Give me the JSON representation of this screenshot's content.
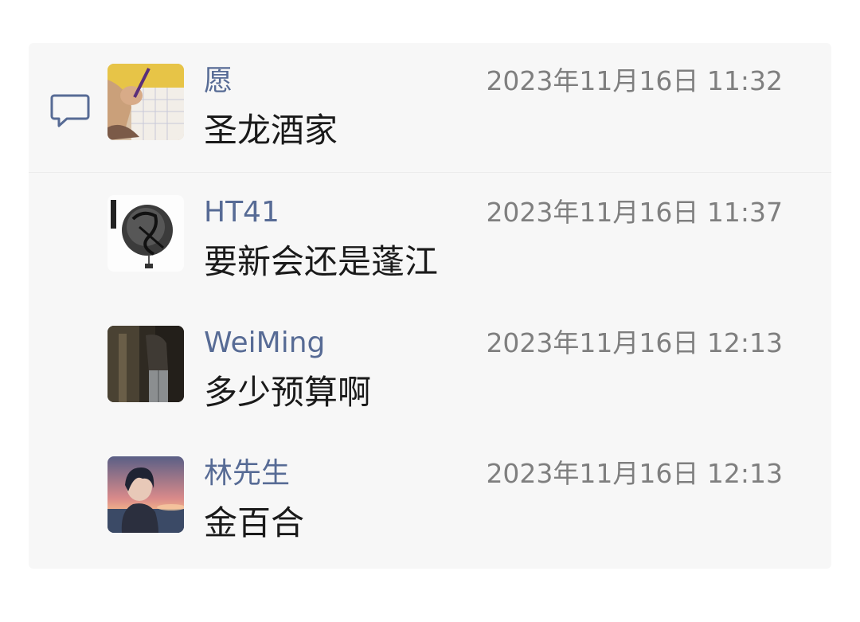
{
  "icons": {
    "comment": "comment-icon"
  },
  "colors": {
    "panel_background": "#f7f7f7",
    "username": "#576b95",
    "timestamp": "#7f7f7f",
    "message": "#1a1a1a",
    "comment_icon": "#576b95"
  },
  "comments": [
    {
      "username": "愿",
      "timestamp": "2023年11月16日 11:32",
      "message": "圣龙酒家",
      "avatar": "handwriting-photo-avatar"
    },
    {
      "username": "HT41",
      "timestamp": "2023年11月16日 11:37",
      "message": "要新会还是蓬江",
      "avatar": "ink-calligraphy-avatar"
    },
    {
      "username": "WeiMing",
      "timestamp": "2023年11月16日 12:13",
      "message": "多少预算啊",
      "avatar": "dark-photo-avatar"
    },
    {
      "username": "林先生",
      "timestamp": "2023年11月16日 12:13",
      "message": "金百合",
      "avatar": "anime-sunset-avatar"
    }
  ]
}
